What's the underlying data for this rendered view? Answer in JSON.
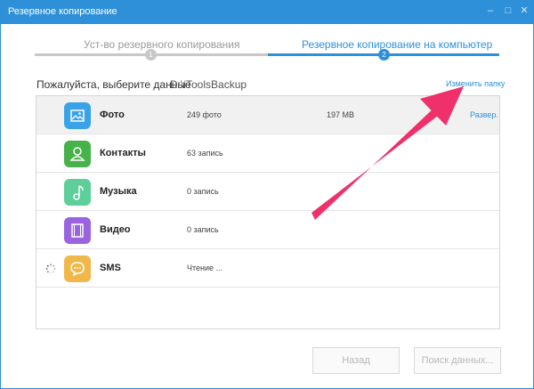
{
  "window": {
    "title": "Резервное копирование",
    "min_glyph": "–",
    "max_glyph": "□",
    "close_glyph": "✕"
  },
  "stepper": {
    "steps": [
      {
        "label": "Уст-во резервного копирования",
        "number": "1",
        "active": false
      },
      {
        "label": "Резервное копирование на компьютер",
        "number": "2",
        "active": true
      }
    ]
  },
  "destination": {
    "prompt": "Пожалуйста, выберите данные",
    "path": "D:\\iToolsBackup",
    "change_folder": "Изменить папку"
  },
  "items": [
    {
      "name": "Фото",
      "count": "249 фото",
      "size": "197 MB",
      "expand": "Развер.",
      "icon": "photo-icon",
      "color": "#3aa3e8"
    },
    {
      "name": "Контакты",
      "count": "63 запись",
      "size": "",
      "expand": "",
      "icon": "contacts-icon",
      "color": "#47b24a"
    },
    {
      "name": "Музыка",
      "count": "0 запись",
      "size": "",
      "expand": "",
      "icon": "music-icon",
      "color": "#5ecf9a"
    },
    {
      "name": "Видео",
      "count": "0 запись",
      "size": "",
      "expand": "",
      "icon": "video-icon",
      "color": "#9a63e0"
    },
    {
      "name": "SMS",
      "count": "Чтение ...",
      "size": "",
      "expand": "",
      "icon": "sms-icon",
      "color": "#f0b84a"
    }
  ],
  "buttons": {
    "back": "Назад",
    "search": "Поиск данных..."
  },
  "colors": {
    "accent": "#2e90d8",
    "annotation_arrow": "#f0306a"
  }
}
